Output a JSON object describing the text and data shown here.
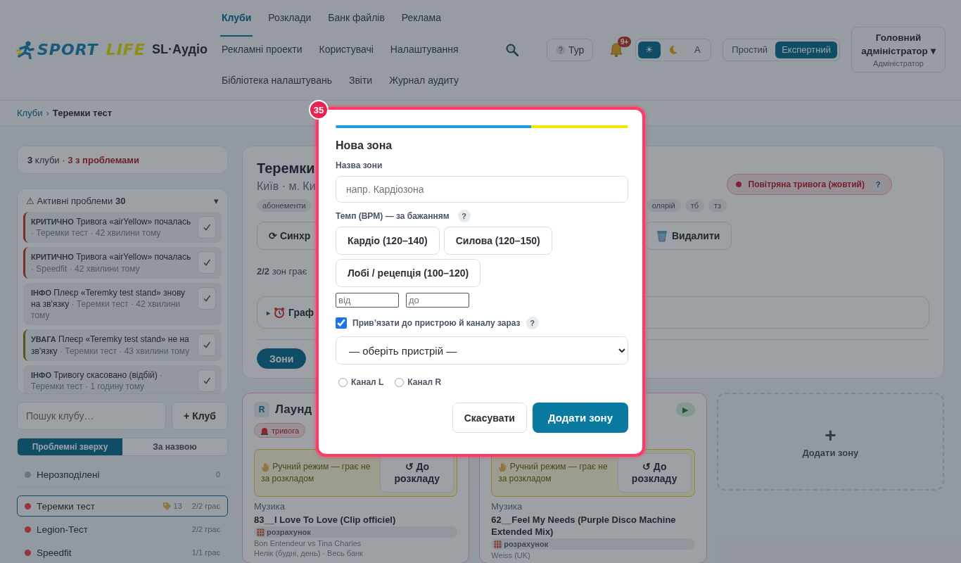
{
  "header": {
    "logo": {
      "first": "SPORT",
      "second": "LIFE"
    },
    "app_name": "SL·Аудіо",
    "nav": [
      [
        {
          "label": "Клуби",
          "selected": true
        },
        {
          "label": "Розклади",
          "selected": false
        },
        {
          "label": "Банк файлів",
          "selected": false
        },
        {
          "label": "Реклама",
          "selected": false
        }
      ],
      [
        {
          "label": "Рекламні проекти",
          "selected": false
        },
        {
          "label": "Користувачі",
          "selected": false
        },
        {
          "label": "Налаштування",
          "selected": false
        }
      ],
      [
        {
          "label": "Бібліотека налаштувань",
          "selected": false
        },
        {
          "label": "Звіти",
          "selected": false
        },
        {
          "label": "Журнал аудиту",
          "selected": false
        }
      ]
    ],
    "tour_button": "Тур",
    "notifications_badge": "9+",
    "theme": [
      {
        "kind": "glyph",
        "label": "☀",
        "selected": true
      },
      {
        "kind": "moon",
        "selected": false
      },
      {
        "kind": "glyph",
        "label": "A",
        "selected": false
      }
    ],
    "mode": [
      {
        "label": "Простий",
        "selected": false
      },
      {
        "label": "Експертний",
        "selected": true
      }
    ],
    "user": {
      "name": "Головний адміністратор",
      "caret": "▾",
      "role": "Адміністратор"
    }
  },
  "breadcrumb": {
    "items": [
      {
        "label": "Клуби",
        "kind": "link"
      },
      {
        "label": "Теремки тест",
        "kind": "current"
      }
    ],
    "separator": "›"
  },
  "sidebar": {
    "summary": {
      "count": "3",
      "text": "клуби ·",
      "problems": "3 з проблемами"
    },
    "problems": {
      "heading": "⚠ Активні проблеми **30**",
      "toggle": "▾",
      "items": [
        {
          "kind": "critical",
          "level": "КРИТИЧНО",
          "title": "Тривога «airYellow» почалась",
          "meta": "· Теремки тест · 42 хвилини тому"
        },
        {
          "kind": "critical",
          "level": "КРИТИЧНО",
          "title": "Тривога «airYellow» почалась",
          "meta": "· Speedfit · 42 хвилини тому"
        },
        {
          "kind": "info",
          "level": "ІНФО",
          "title": "Плеєр «Teremky test stand» знову на зв'язку",
          "meta": "· Теремки тест · 42 хвилини тому"
        },
        {
          "kind": "warning",
          "level": "УВАГА",
          "title": "Плеєр «Teremky test stand» не на зв'язку",
          "meta": "· Теремки тест · 43 хвилини тому"
        },
        {
          "kind": "info",
          "level": "ІНФО",
          "title": "Тривогу скасовано (відбій)",
          "meta": "· Теремки тест · 1 годину тому"
        }
      ]
    },
    "search_placeholder": "Пошук клубу…",
    "add_button": "+ Клуб",
    "sort": [
      {
        "label": "Проблемні зверху",
        "selected": true
      },
      {
        "label": "За назвою",
        "selected": false
      }
    ],
    "clubs": [
      {
        "kind": "unassigned",
        "name": "Нерозподілені",
        "color": "#70757d",
        "status": "0",
        "selected": false
      },
      {
        "kind": "club",
        "name": "Теремки тест",
        "color": "#953540",
        "tags": "13",
        "status": "2/2 грає",
        "selected": true
      },
      {
        "kind": "club",
        "name": "Legion-Тест",
        "color": "#953540",
        "status": "2/2 грає",
        "selected": false
      },
      {
        "kind": "club",
        "name": "Speedfit",
        "color": "#953540",
        "status": "1/1 грає",
        "selected": false
      }
    ]
  },
  "club": {
    "title": "Теремки",
    "subtitle": "Київ · м. Ки",
    "tags_left": [
      "абонементи"
    ],
    "tags_right": [
      "олярій",
      "тб",
      "тз"
    ],
    "alert": {
      "label": "Повітряна тривога (жовтий)",
      "help": "?"
    },
    "actions": [
      {
        "kind": "sync",
        "label": "⟳ Синхр"
      },
      {
        "kind": "delete",
        "label": "Видалити"
      }
    ],
    "playing": "**2/2** зон грає",
    "schedule": {
      "caret": "▸",
      "label": "Граф"
    },
    "tabs": [
      {
        "label": "Зони",
        "selected": true
      }
    ],
    "zones": [
      {
        "kind": "zone",
        "badge": "R",
        "title": "Лаунд",
        "alarm_tag": "тривога",
        "manual": "Ручний режим — грає не за розкладом",
        "resume": "↺ До розкладу",
        "section": "Музика",
        "track": "83__I Love To Love (Clip officiel)",
        "category": "розрахунок",
        "artist": "Bon Entendeur vs Tina Charles",
        "source": "Нелік (будні, день) · Весь банк"
      },
      {
        "kind": "zone",
        "play": "▶",
        "manual": "Ручний режим — грає не за розкладом",
        "resume": "↺ До розкладу",
        "section": "Музика",
        "track": "62__Feel My Needs (Purple Disco Machine Extended Mix)",
        "category": "розрахунок",
        "artist": "Weiss (UK)"
      },
      {
        "kind": "add",
        "plus": "+",
        "label": "Додати зону"
      }
    ]
  },
  "modal": {
    "step_badge": "35",
    "title": "Нова зона",
    "name_label": "Назва зони",
    "name_placeholder": "напр. Кардіозона",
    "tempo_label": "Темп (BPM) — за бажанням",
    "tempo_help": "?",
    "presets": [
      "Кардіо (120–140)",
      "Силова (120–150)",
      "Лобі / рецепція (100–120)"
    ],
    "from_placeholder": "від",
    "to_placeholder": "до",
    "bind": {
      "label": "Прив’язати до пристрою й каналу зараз",
      "checked": true,
      "help": "?"
    },
    "device_select": "— оберіть пристрій —",
    "channels": [
      {
        "label": "Канал L",
        "selected": false
      },
      {
        "label": "Канал R",
        "selected": false
      }
    ],
    "cancel": "Скасувати",
    "submit": "Додати зону"
  }
}
